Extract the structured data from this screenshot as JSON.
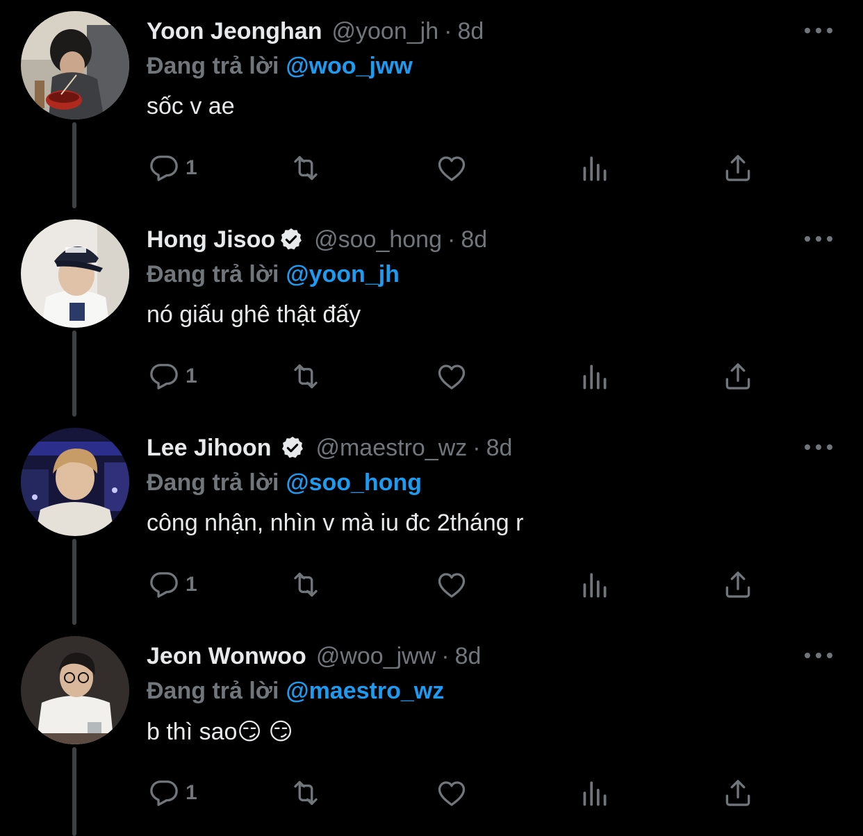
{
  "colors": {
    "background": "#000000",
    "primary_text": "#e7e9ea",
    "secondary_text": "#71767b",
    "link": "#1d9bf0",
    "thread_line": "#3e4144",
    "verified_badge": "#e7e9ea"
  },
  "reply_prefix": "Đang trả lời",
  "tweets": [
    {
      "display_name": "Yoon Jeonghan",
      "verified": false,
      "handle": "@yoon_jh",
      "separator": "·",
      "time": "8d",
      "reply_to": "@woo_jww",
      "text": "sốc v ae",
      "reply_count": "1",
      "avatar_icon": "profile-photo"
    },
    {
      "display_name": "Hong Jisoo",
      "verified": true,
      "handle": "@soo_hong",
      "separator": "·",
      "time": "8d",
      "reply_to": "@yoon_jh",
      "text": "nó giấu ghê thật đấy",
      "reply_count": "1",
      "avatar_icon": "profile-photo"
    },
    {
      "display_name": "Lee Jihoon",
      "verified": true,
      "handle": "@maestro_wz",
      "separator": "·",
      "time": "8d",
      "reply_to": "@soo_hong",
      "text": "công nhận, nhìn v mà iu đc 2tháng r",
      "reply_count": "1",
      "avatar_icon": "profile-photo"
    },
    {
      "display_name": "Jeon Wonwoo",
      "verified": false,
      "handle": "@woo_jww",
      "separator": "·",
      "time": "8d",
      "reply_to": "@maestro_wz",
      "text": "b thì sao😏 😏",
      "reply_count": "1",
      "avatar_icon": "profile-photo"
    }
  ],
  "action_icons": [
    "reply-icon",
    "retweet-icon",
    "like-icon",
    "views-icon",
    "share-icon"
  ],
  "more_icon": "more-options-icon"
}
